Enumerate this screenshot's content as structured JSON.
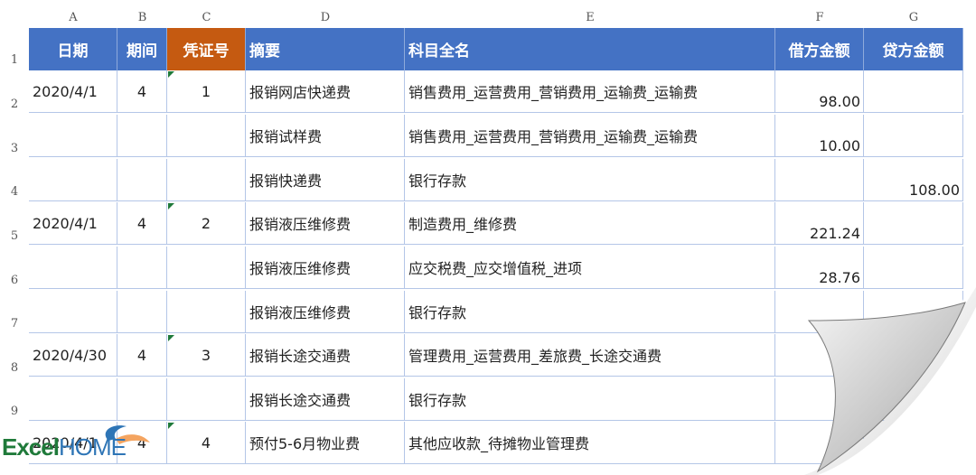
{
  "columns": [
    "A",
    "B",
    "C",
    "D",
    "E",
    "F",
    "G"
  ],
  "headers": [
    "日期",
    "期间",
    "凭证号",
    "摘要",
    "科目全名",
    "借方金额",
    "贷方金额"
  ],
  "rows": [
    {
      "num": "1"
    },
    {
      "num": "2",
      "date": "2020/4/1",
      "period": "4",
      "voucher": "1",
      "summary": "报销网店快递费",
      "account": "销售费用_运营费用_营销费用_运输费_运输费",
      "debit": "98.00",
      "credit": ""
    },
    {
      "num": "3",
      "date": "",
      "period": "",
      "voucher": "",
      "summary": "报销试样费",
      "account": "销售费用_运营费用_营销费用_运输费_运输费",
      "debit": "10.00",
      "credit": ""
    },
    {
      "num": "4",
      "date": "",
      "period": "",
      "voucher": "",
      "summary": "报销快递费",
      "account": "银行存款",
      "debit": "",
      "credit": "108.00"
    },
    {
      "num": "5",
      "date": "2020/4/1",
      "period": "4",
      "voucher": "2",
      "summary": "报销液压维修费",
      "account": "制造费用_维修费",
      "debit": "221.24",
      "credit": ""
    },
    {
      "num": "6",
      "date": "",
      "period": "",
      "voucher": "",
      "summary": "报销液压维修费",
      "account": "应交税费_应交增值税_进项",
      "debit": "28.76",
      "credit": ""
    },
    {
      "num": "7",
      "date": "",
      "period": "",
      "voucher": "",
      "summary": "报销液压维修费",
      "account": "银行存款",
      "debit": "",
      "credit": ""
    },
    {
      "num": "8",
      "date": "2020/4/30",
      "period": "4",
      "voucher": "3",
      "summary": "报销长途交通费",
      "account": "管理费用_运营费用_差旅费_长途交通费",
      "debit": "",
      "credit": ""
    },
    {
      "num": "9",
      "date": "",
      "period": "",
      "voucher": "",
      "summary": "报销长途交通费",
      "account": "银行存款",
      "debit": "",
      "credit": ""
    },
    {
      "num": "",
      "date": "2020/4/1",
      "period": "4",
      "voucher": "4",
      "summary": "预付5-6月物业费",
      "account": "其他应收款_待摊物业管理费",
      "debit": "",
      "credit": ""
    }
  ],
  "logo": {
    "text_left": "Excel",
    "text_right": "HOME"
  },
  "colors": {
    "header_blue": "#4472c4",
    "header_orange": "#c55a11",
    "grid": "#b4c6e7",
    "flag": "#1f7a3a"
  }
}
